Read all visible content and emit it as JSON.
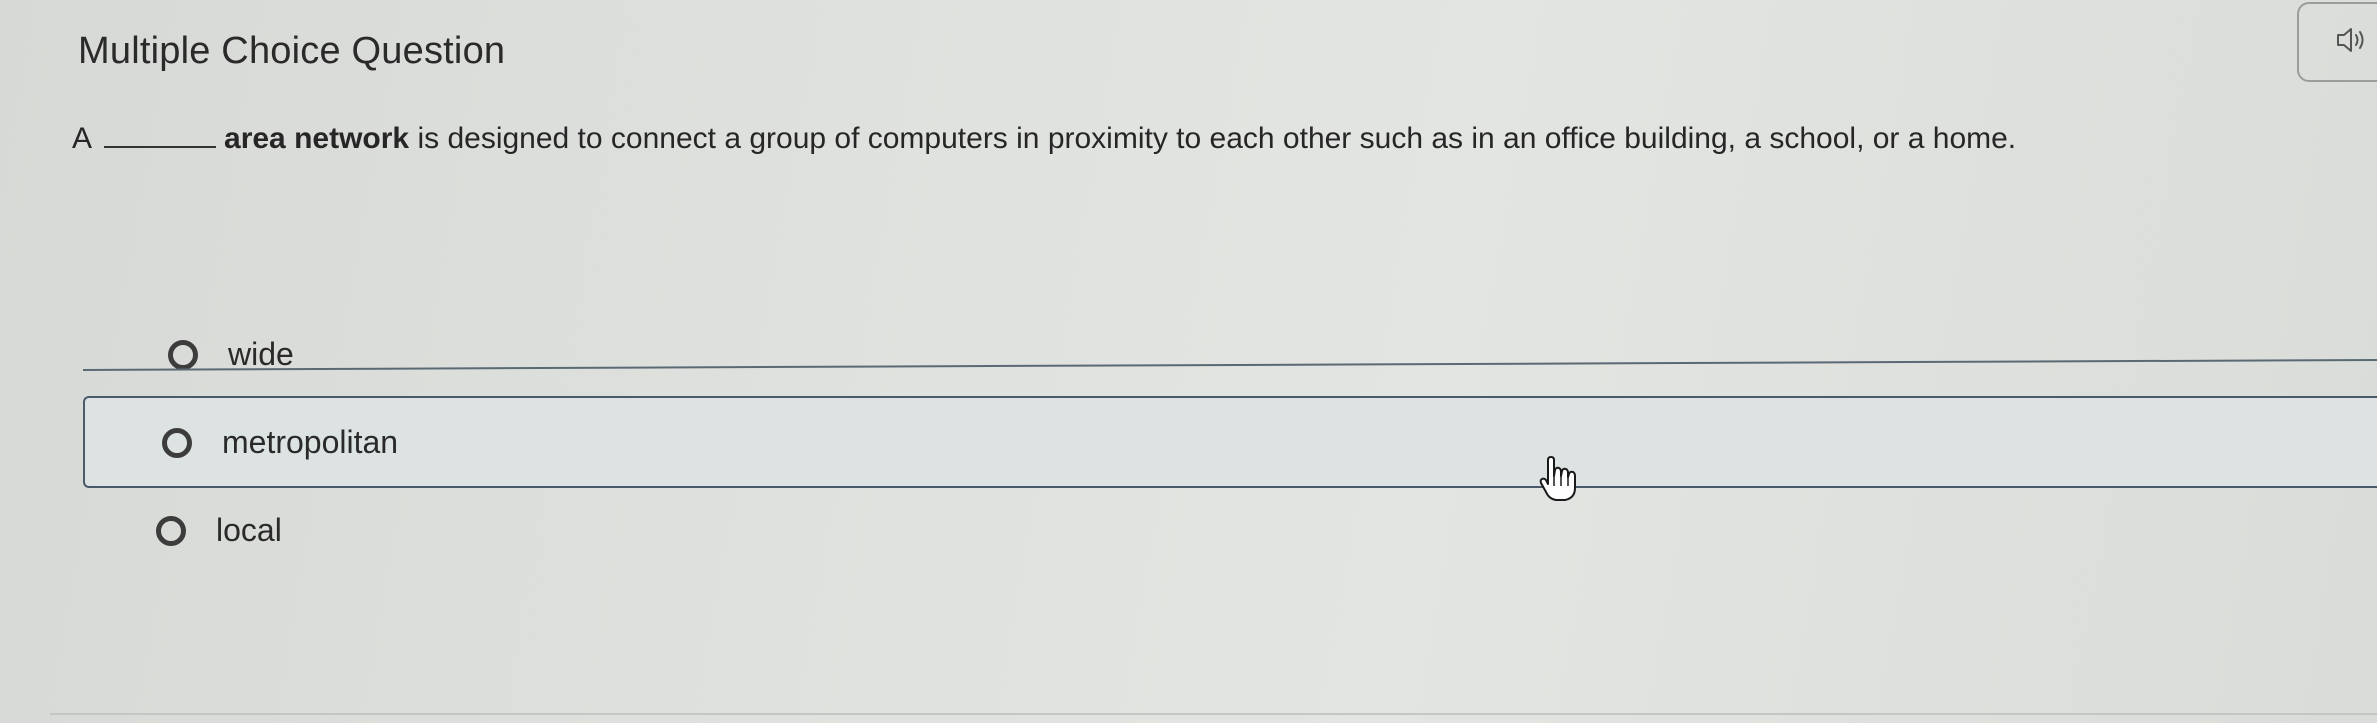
{
  "header": {
    "title": "Multiple Choice Question",
    "audio_icon": "speaker-icon"
  },
  "question": {
    "prefix": "A",
    "bold_text": "area network",
    "suffix": " is designed to connect a group of computers in proximity to each other such as in an office building, a school, or a home."
  },
  "options": [
    {
      "label": "wide",
      "selected": false
    },
    {
      "label": "metropolitan",
      "selected": false,
      "hovered": true
    },
    {
      "label": "local",
      "selected": false
    }
  ],
  "colors": {
    "background": "#dfe1de",
    "hover_fill": "#dce3e2",
    "hover_border": "#4a5a6a",
    "text": "#262626"
  },
  "icons": {
    "cursor": "hand-pointer-icon",
    "radio": "radio-empty-icon"
  }
}
